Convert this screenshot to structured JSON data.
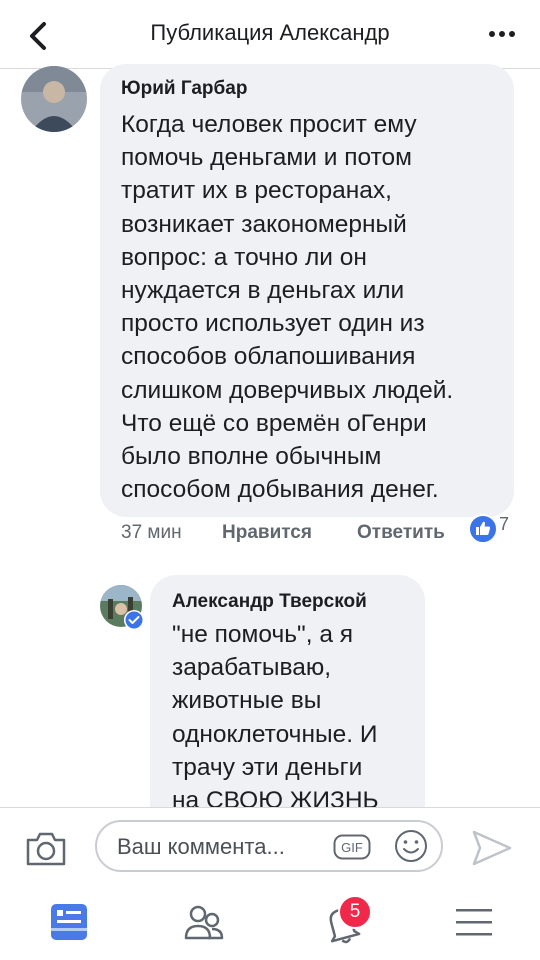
{
  "header": {
    "title": "Публикация Александр",
    "back_icon": "chevron-left-icon",
    "more_icon": "ellipsis-icon"
  },
  "comments": [
    {
      "author": "Юрий Гарбар",
      "text": "Когда человек просит ему\nпомочь деньгами и потом\nтратит их в ресторанах,\nвозникает закономерный\nвопрос: а точно ли он\nнуждается в деньгах или\nпросто использует один из\nспособов облапошивания\nслишком доверчивых людей.\nЧто ещё со времён оГенри\nбыло вполне обычным\nспособом добывания денег.",
      "time": "37 мин",
      "like_label": "Нравится",
      "reply_label": "Ответить",
      "reactions": "7"
    },
    {
      "author": "Александр Тверской",
      "text": "\"не помочь\", а я\nзарабатываю,\nживотные вы\nодноклеточные. И\nтрачу эти деньги\nна СВОЮ ЖИЗНЬ"
    }
  ],
  "composer": {
    "placeholder": "Ваш коммента...",
    "gif_label": "GIF"
  },
  "tabbar": {
    "notification_count": "5"
  },
  "colors": {
    "accent": "#3b73e8",
    "badge": "#f02849",
    "bubble": "#f0f1f4"
  }
}
